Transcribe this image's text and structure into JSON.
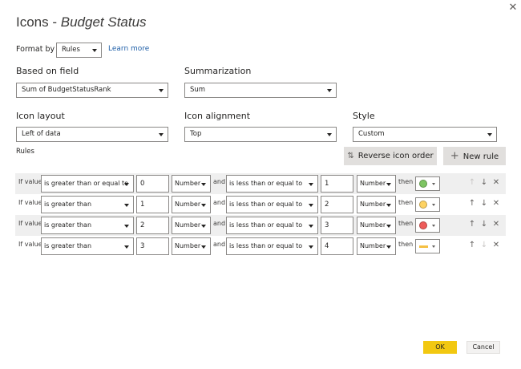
{
  "dialog": {
    "title_main": "Icons - ",
    "title_italic": "Budget Status",
    "format_by_label": "Format by",
    "format_by_value": "Rules",
    "learn_more": "Learn more",
    "based_on_label": "Based on field",
    "based_on_value": "Sum of BudgetStatusRank",
    "summarization_label": "Summarization",
    "summarization_value": "Sum",
    "icon_layout_label": "Icon layout",
    "icon_layout_value": "Left of data",
    "icon_alignment_label": "Icon alignment",
    "icon_alignment_value": "Top",
    "style_label": "Style",
    "style_value": "Custom",
    "rules_label": "Rules",
    "reverse_label": "Reverse icon order",
    "new_rule_label": "New rule",
    "ok_label": "OK",
    "cancel_label": "Cancel"
  },
  "rule_text": {
    "if_value": "If value",
    "and": "and",
    "then": "then"
  },
  "rules": [
    {
      "op1": "is greater than or equal to",
      "val1": "0",
      "type1": "Number",
      "op2": "is less than or equal to",
      "val2": "1",
      "type2": "Number",
      "icon": "green-circle-icon",
      "icon_color": "#7dc462"
    },
    {
      "op1": "is greater than",
      "val1": "1",
      "type1": "Number",
      "op2": "is less than or equal to",
      "val2": "2",
      "type2": "Number",
      "icon": "yellow-circle-icon",
      "icon_color": "#fdd262"
    },
    {
      "op1": "is greater than",
      "val1": "2",
      "type1": "Number",
      "op2": "is less than or equal to",
      "val2": "3",
      "type2": "Number",
      "icon": "red-circle-icon",
      "icon_color": "#ee5c5a"
    },
    {
      "op1": "is greater than",
      "val1": "3",
      "type1": "Number",
      "op2": "is less than or equal to",
      "val2": "4",
      "type2": "Number",
      "icon": "yellow-dash-icon",
      "icon_color": "#f5c043"
    }
  ]
}
